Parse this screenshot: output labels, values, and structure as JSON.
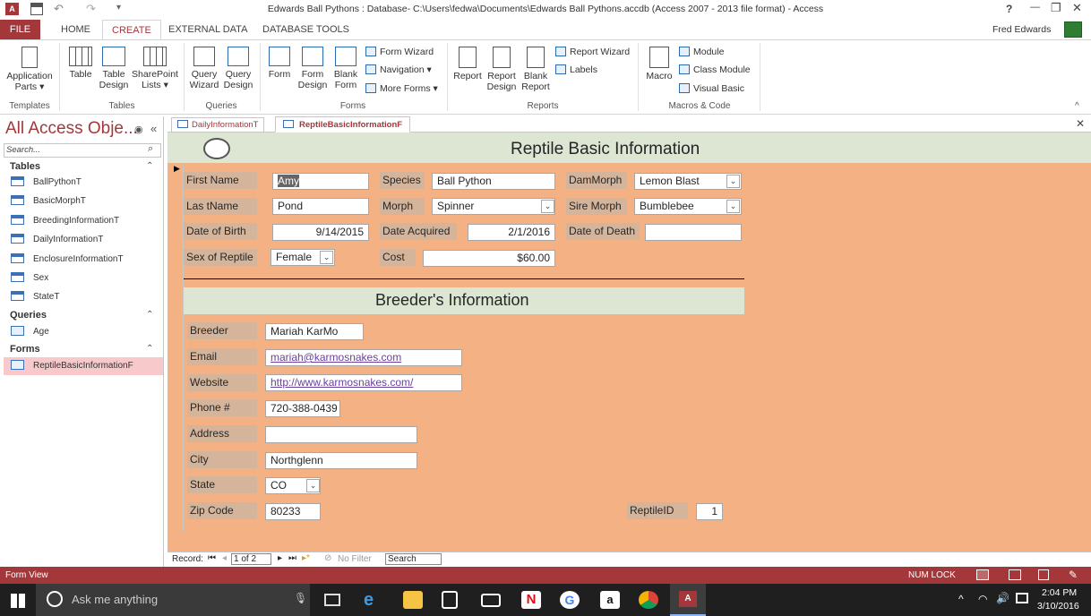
{
  "window": {
    "title": "Edwards Ball Pythons : Database- C:\\Users\\fedwa\\Documents\\Edwards Ball Pythons.accdb (Access 2007 - 2013 file format) - Access",
    "help": "?",
    "user": "Fred Edwards",
    "controls": [
      "—",
      "▫",
      "✕"
    ]
  },
  "ribbon_tabs": [
    "FILE",
    "HOME",
    "CREATE",
    "EXTERNAL DATA",
    "DATABASE TOOLS"
  ],
  "ribbon": {
    "templates": {
      "group": "Templates",
      "app_parts": "Application Parts"
    },
    "tables": {
      "group": "Tables",
      "table": "Table",
      "table_design": "Table Design",
      "sharepoint": "SharePoint Lists"
    },
    "queries": {
      "group": "Queries",
      "wizard": "Query Wizard",
      "design": "Query Design"
    },
    "forms": {
      "group": "Forms",
      "form": "Form",
      "form_design": "Form Design",
      "blank_form": "Blank Form",
      "form_wizard": "Form Wizard",
      "navigation": "Navigation",
      "more_forms": "More Forms"
    },
    "reports": {
      "group": "Reports",
      "report": "Report",
      "report_design": "Report Design",
      "blank_report": "Blank Report",
      "report_wizard": "Report Wizard",
      "labels": "Labels"
    },
    "macros": {
      "group": "Macros & Code",
      "macro": "Macro",
      "module": "Module",
      "class_module": "Class Module",
      "visual_basic": "Visual Basic"
    }
  },
  "nav": {
    "title": "All Access Obje...",
    "search_placeholder": "Search...",
    "sections": {
      "tables": "Tables",
      "queries": "Queries",
      "forms": "Forms"
    },
    "tables": [
      "BallPythonT",
      "BasicMorphT",
      "BreedingInformationT",
      "DailyInformationT",
      "EnclosureInformationT",
      "Sex",
      "StateT"
    ],
    "queries": [
      "Age"
    ],
    "forms": [
      "ReptileBasicInformationF"
    ]
  },
  "doc_tabs": [
    "DailyInformationT",
    "ReptileBasicInformationF"
  ],
  "form": {
    "title": "Reptile Basic Information",
    "labels": {
      "first_name": "First Name",
      "last_name": "Las tName",
      "dob": "Date of Birth",
      "sex": "Sex of Reptile",
      "species": "Species",
      "morph": "Morph",
      "date_acquired": "Date Acquired",
      "cost": "Cost",
      "dam_morph": "DamMorph",
      "sire_morph": "Sire Morph",
      "date_of_death": "Date of Death"
    },
    "values": {
      "first_name": "Amy",
      "last_name": "Pond",
      "dob": "9/14/2015",
      "sex": "Female",
      "species": "Ball Python",
      "morph": "Spinner",
      "date_acquired": "2/1/2016",
      "cost": "$60.00",
      "dam_morph": "Lemon Blast",
      "sire_morph": "Bumblebee",
      "date_of_death": ""
    },
    "breeder_title": "Breeder's Information",
    "breeder_labels": {
      "breeder": "Breeder",
      "email": "Email",
      "website": "Website",
      "phone": "Phone #",
      "address": "Address",
      "city": "City",
      "state": "State",
      "zip": "Zip Code",
      "reptile_id": "ReptileID"
    },
    "breeder_values": {
      "breeder": "Mariah KarMo",
      "email": "mariah@karmosnakes.com",
      "website": "http://www.karmosnakes.com/",
      "phone": "720-388-0439",
      "address": "",
      "city": "Northglenn",
      "state": "CO",
      "zip": "80233",
      "reptile_id": "1"
    }
  },
  "record_nav": {
    "label": "Record:",
    "position": "1 of 2",
    "filter": "No Filter",
    "search": "Search"
  },
  "status": {
    "left": "Form View",
    "numlock": "NUM LOCK"
  },
  "taskbar": {
    "search": "Ask me anything",
    "time": "2:04 PM",
    "date": "3/10/2016"
  },
  "colors": {
    "accent": "#a4373a",
    "form_body": "#f4b183",
    "form_header": "#dde6d2",
    "label_bg": "#d4b59c"
  }
}
